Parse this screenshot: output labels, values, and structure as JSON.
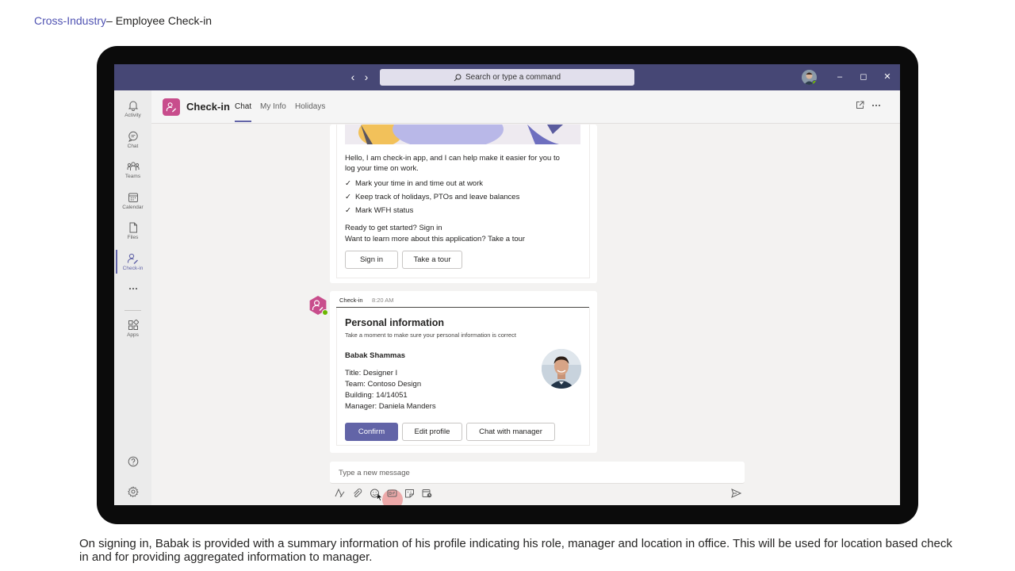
{
  "slide": {
    "title_link": "Cross-Industry",
    "title_rest": "– Employee Check-in",
    "caption": "On signing in, Babak is provided with a summary information of his profile indicating his role, manager and location in office. This will be used for location based check in and for providing aggregated information to manager."
  },
  "titlebar": {
    "search_placeholder": "Search or type a command"
  },
  "rail": {
    "items": [
      {
        "label": "Activity",
        "icon": "bell-icon"
      },
      {
        "label": "Chat",
        "icon": "chat-icon"
      },
      {
        "label": "Teams",
        "icon": "teams-icon"
      },
      {
        "label": "Calendar",
        "icon": "calendar-icon"
      },
      {
        "label": "Files",
        "icon": "file-icon"
      },
      {
        "label": "Check-in",
        "icon": "checkin-icon"
      },
      {
        "label": "Apps",
        "icon": "apps-icon"
      }
    ],
    "active": "Check-in"
  },
  "app": {
    "name": "Check-in",
    "tabs": [
      "Chat",
      "My Info",
      "Holidays"
    ],
    "active_tab": "Chat"
  },
  "welcome_card": {
    "intro": "Hello, I am check-in app, and I can help make it easier for you to log your time on work.",
    "intro_line1": "Hello, I am check-in app, and I can help make it easier for you to",
    "intro_line2": "log your time on work.",
    "bullets": [
      "Mark your time in and time out at work",
      "Keep track of holidays, PTOs and leave balances",
      "Mark WFH status"
    ],
    "prompt_line1": "Ready to get started? Sign in",
    "prompt_line2": "Want to learn more about this application? Take a tour",
    "sign_in_label": "Sign in",
    "tour_label": "Take a tour"
  },
  "message": {
    "sender": "Check-in",
    "time": "8:20 AM"
  },
  "profile_card": {
    "title": "Personal information",
    "subtitle": "Take a moment to make sure your personal information is correct",
    "name": "Babak Shammas",
    "fields": [
      "Title: Designer I",
      "Team: Contoso Design",
      "Building: 14/14051",
      "Manager: Daniela Manders"
    ],
    "confirm_label": "Confirm",
    "edit_label": "Edit profile",
    "chat_manager_label": "Chat with manager"
  },
  "composer": {
    "placeholder": "Type a new message"
  },
  "colors": {
    "titlebar": "#464775",
    "accent": "#6264a7",
    "app_brand": "#c84d8c",
    "presence_available": "#6bb700"
  }
}
